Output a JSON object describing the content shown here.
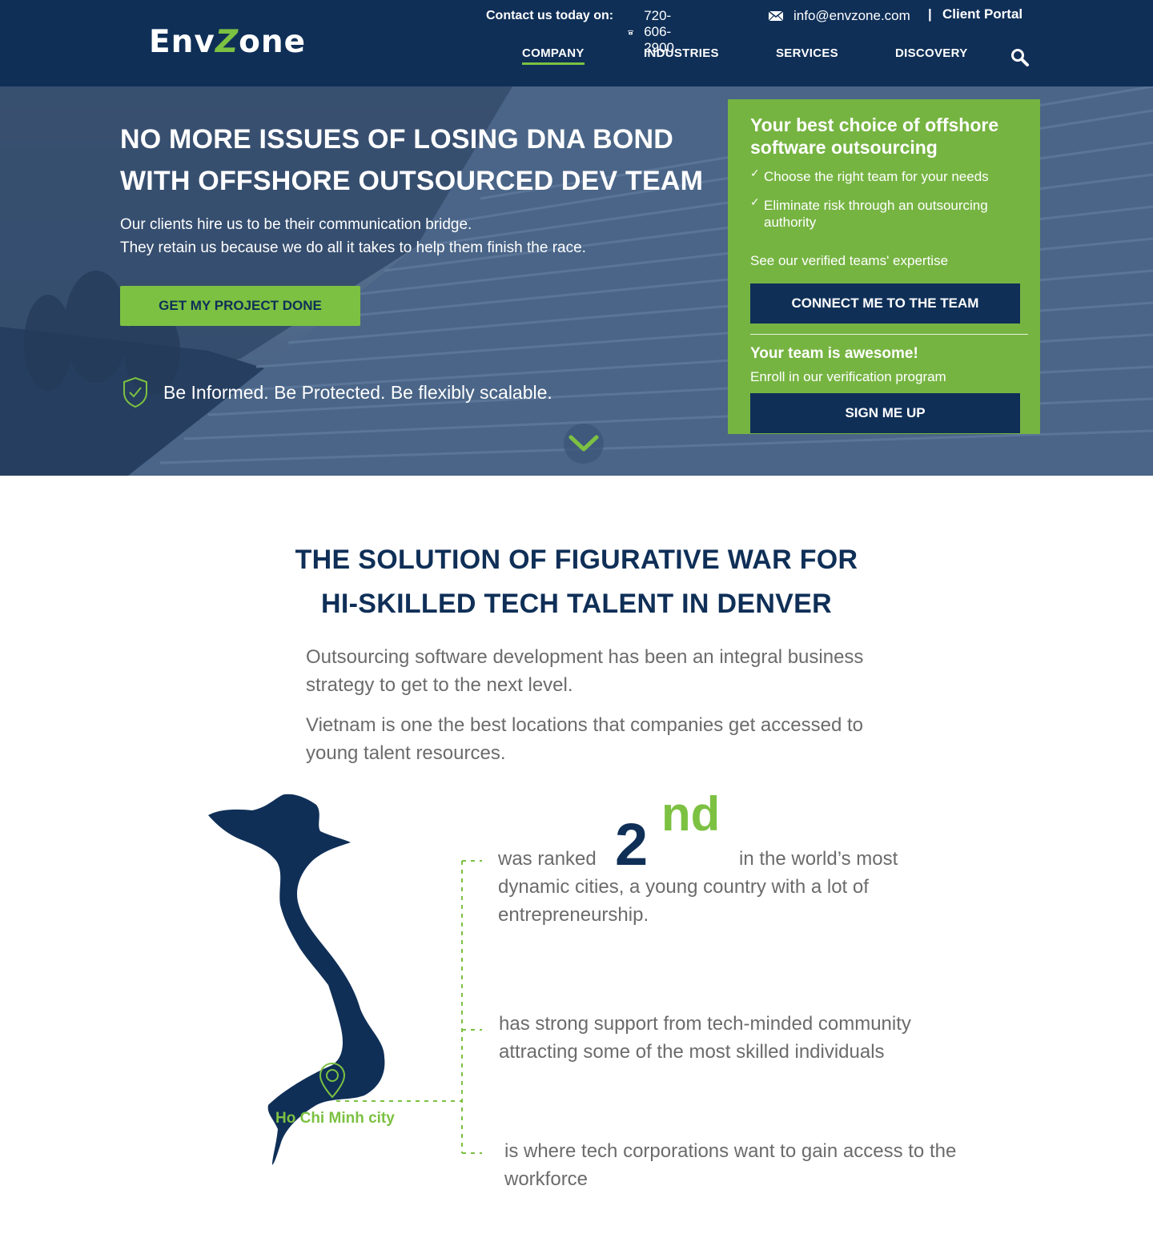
{
  "header": {
    "logo_prefix": "Env",
    "logo_z": "Z",
    "logo_suffix": "one",
    "contact_label": "Contact us today on:",
    "phone": "720-606-2900",
    "email": "info@envzone.com",
    "separator": "|",
    "client_portal": "Client Portal",
    "nav": [
      {
        "label": "COMPANY",
        "active": true
      },
      {
        "label": "INDUSTRIES",
        "active": false
      },
      {
        "label": "SERVICES",
        "active": false
      },
      {
        "label": "DISCOVERY",
        "active": false
      }
    ]
  },
  "hero": {
    "title_line1": "NO MORE ISSUES OF LOSING DNA BOND",
    "title_line2": "WITH OFFSHORE OUTSOURCED DEV TEAM",
    "subtitle_line1": "Our clients hire us to be their communication bridge.",
    "subtitle_line2": "They retain us because we do all it takes to help them finish the race.",
    "cta_label": "GET MY PROJECT DONE",
    "tagline": "Be Informed. Be Protected. Be flexibly scalable."
  },
  "card": {
    "title": "Your best choice of offshore software outsourcing",
    "check1": "Choose the right team for your needs",
    "check2": "Eliminate risk through an outsourcing authority",
    "verified": "See our verified teams' expertise",
    "connect_label": "CONNECT ME TO THE TEAM",
    "awesome": "Your team is awesome!",
    "enroll": "Enroll in our verification program",
    "signup_label": "SIGN ME UP"
  },
  "solution": {
    "title_line1": "THE SOLUTION OF FIGURATIVE WAR FOR",
    "title_line2": "HI-SKILLED TECH TALENT IN DENVER",
    "para1": "Outsourcing software development has been an integral business strategy to get to the next level.",
    "para2": "Vietnam is one the best locations that companies get accessed to young talent resources.",
    "map_label": "Ho Chi Minh city",
    "fact1_lead": "was ranked",
    "fact1_rank": "2",
    "fact1_suffix": "nd",
    "fact1_tail": "in the world’s most",
    "fact1_rest": "dynamic cities, a young country with a lot of entrepreneurship.",
    "fact2": "has strong support from tech-minded community attracting some of the most skilled individuals",
    "fact3": "is where tech corporations want to gain access to the workforce"
  },
  "colors": {
    "navy": "#0f2f57",
    "green": "#7cc142",
    "card_green": "#76b442",
    "body_gray": "#6b6b6b"
  },
  "icons": [
    "phone-icon",
    "mail-icon",
    "search-icon",
    "shield-check-icon",
    "chevron-down-icon",
    "map-pin-icon",
    "check-icon"
  ]
}
